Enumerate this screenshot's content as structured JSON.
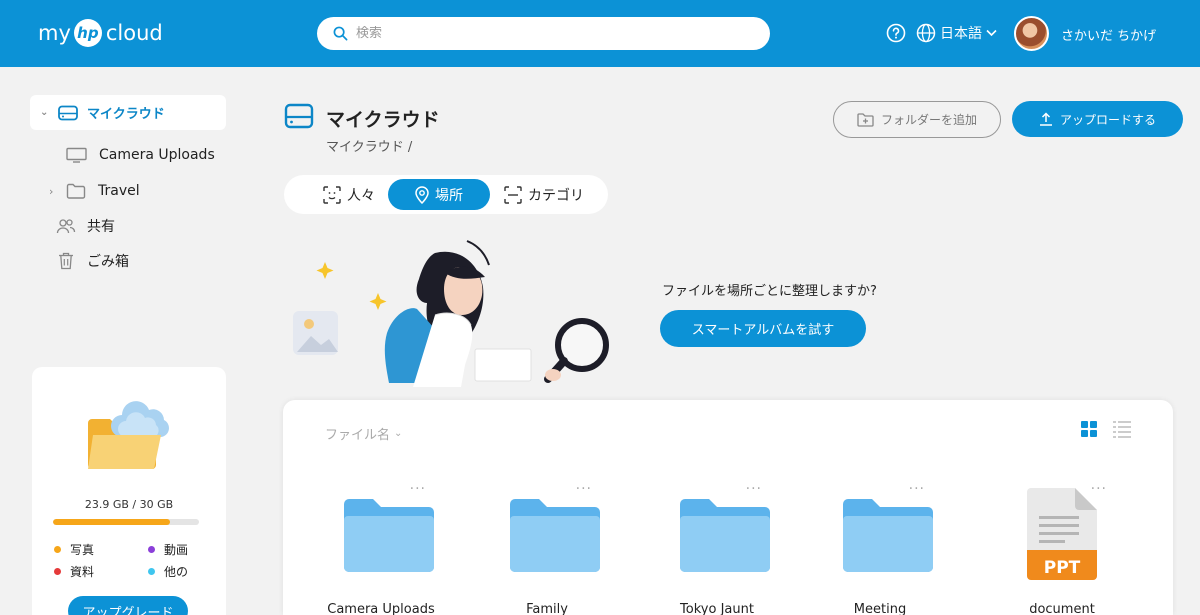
{
  "header": {
    "logo_my": "my",
    "logo_hp": "hp",
    "logo_cloud": "cloud",
    "search_placeholder": "検索",
    "language": "日本語",
    "username": "さかいだ ちかげ",
    "colors": {
      "brand": "#0c92d6"
    }
  },
  "sidebar": {
    "items": [
      {
        "label": "マイクラウド",
        "icon": "drive-icon",
        "active": true
      },
      {
        "label": "Camera Uploads",
        "icon": "monitor-icon"
      },
      {
        "label": "Travel",
        "icon": "folder-icon"
      },
      {
        "label": "共有",
        "icon": "people-icon"
      },
      {
        "label": "ごみ箱",
        "icon": "trash-icon"
      }
    ],
    "storage": {
      "used_text": "23.9 GB / 30 GB",
      "used_fraction": 0.8,
      "legend": [
        {
          "label": "写真",
          "color": "#f6a619"
        },
        {
          "label": "動画",
          "color": "#8b3fd9"
        },
        {
          "label": "資料",
          "color": "#e53a3a"
        },
        {
          "label": "他の",
          "color": "#3fc6ef"
        }
      ],
      "upgrade_label": "アップグレード"
    }
  },
  "main": {
    "title": "マイクラウド",
    "breadcrumb": "マイクラウド /",
    "add_folder_label": "フォルダーを追加",
    "upload_label": "アップロードする",
    "tabs": [
      {
        "label": "人々",
        "icon": "face-scan-icon"
      },
      {
        "label": "場所",
        "icon": "location-pin-icon",
        "active": true
      },
      {
        "label": "カテゴリ",
        "icon": "category-scan-icon"
      }
    ],
    "promo": {
      "question": "ファイルを場所ごとに整理しますか?",
      "button": "スマートアルバムを試す"
    },
    "files": {
      "sort_label": "ファイル名",
      "more_label": "...",
      "items": [
        {
          "name": "Camera Uploads",
          "type": "folder"
        },
        {
          "name": "Family",
          "type": "folder"
        },
        {
          "name": "Tokyo Jaunt",
          "type": "folder"
        },
        {
          "name": "Meeting",
          "type": "folder"
        },
        {
          "name": "document",
          "type": "ppt",
          "badge": "PPT"
        }
      ]
    }
  }
}
